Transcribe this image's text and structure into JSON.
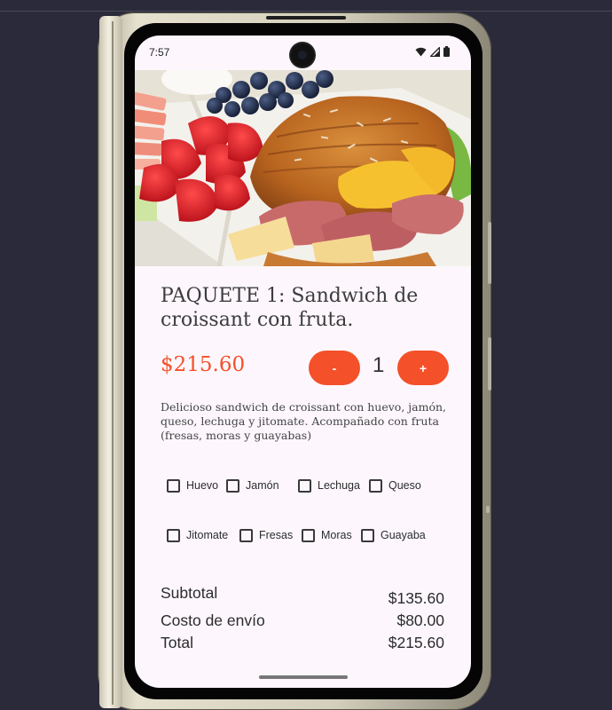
{
  "status_bar": {
    "time": "7:57",
    "icons": [
      "wifi-icon",
      "signal-icon",
      "battery-icon"
    ]
  },
  "product": {
    "image": "croissant-sandwich-with-fruit-photo",
    "title": "PAQUETE 1: Sandwich de croissant con fruta.",
    "price": "$215.60",
    "description": "Delicioso sandwich de croissant con huevo, jamón, queso, lechuga y jitomate. Acompañado con fruta (fresas, moras y guayabas)"
  },
  "quantity": {
    "minus_label": "-",
    "value": "1",
    "plus_label": "+"
  },
  "ingredients": {
    "row1": [
      "Huevo",
      "Jamón",
      "Lechuga",
      "Queso"
    ],
    "row2": [
      "Jitomate",
      "Fresas",
      "Moras",
      "Guayaba"
    ],
    "checked": [
      false,
      false,
      false,
      false,
      false,
      false,
      false,
      false
    ]
  },
  "summary": {
    "subtotal_label": "Subtotal",
    "subtotal_value": "$135.60",
    "shipping_label": "Costo de envío",
    "shipping_value": "$80.00",
    "total_label": "Total",
    "total_value": "$215.60"
  },
  "colors": {
    "accent": "#f4502a",
    "screen_bg": "#fdf7fd",
    "page_bg": "#2b2a3a"
  }
}
